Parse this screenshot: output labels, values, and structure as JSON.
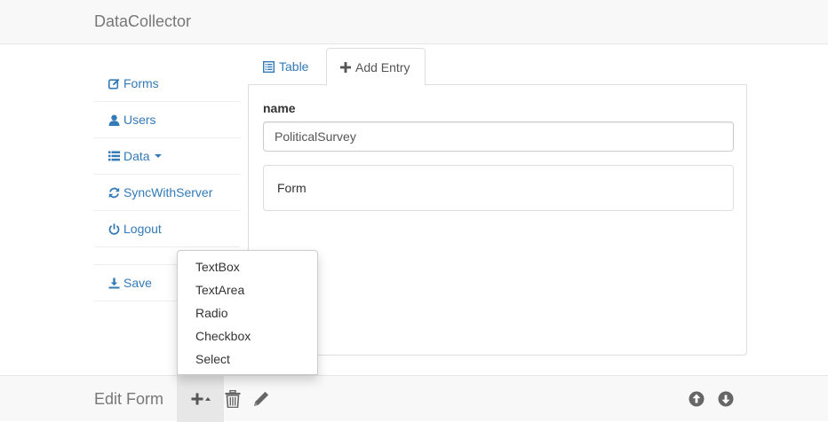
{
  "navbar": {
    "brand": "DataCollector"
  },
  "sidebar": {
    "items": [
      {
        "label": "Forms",
        "icon": "edit-icon"
      },
      {
        "label": "Users",
        "icon": "user-icon"
      },
      {
        "label": "Data",
        "icon": "list-icon",
        "has_caret": true
      },
      {
        "label": "SyncWithServer",
        "icon": "refresh-icon"
      },
      {
        "label": "Logout",
        "icon": "power-icon"
      },
      {
        "label": "Save",
        "icon": "download-icon"
      }
    ]
  },
  "tabs": [
    {
      "label": "Table",
      "icon": "table-list-icon",
      "active": false
    },
    {
      "label": "Add Entry",
      "icon": "plus-icon",
      "active": true
    }
  ],
  "form": {
    "name_label": "name",
    "name_value": "PoliticalSurvey",
    "form_section_label": "Form"
  },
  "dropdown": {
    "items": [
      "TextBox",
      "TextArea",
      "Radio",
      "Checkbox",
      "Select"
    ]
  },
  "bottombar": {
    "title": "Edit Form",
    "tools": [
      "plus-dropdown-icon",
      "trash-icon",
      "pencil-icon",
      "arrow-up-circle-icon",
      "arrow-down-circle-icon"
    ]
  },
  "colors": {
    "link": "#337ab7",
    "navbar_bg": "#f8f8f8",
    "muted_text": "#777777",
    "border": "#dddddd"
  }
}
